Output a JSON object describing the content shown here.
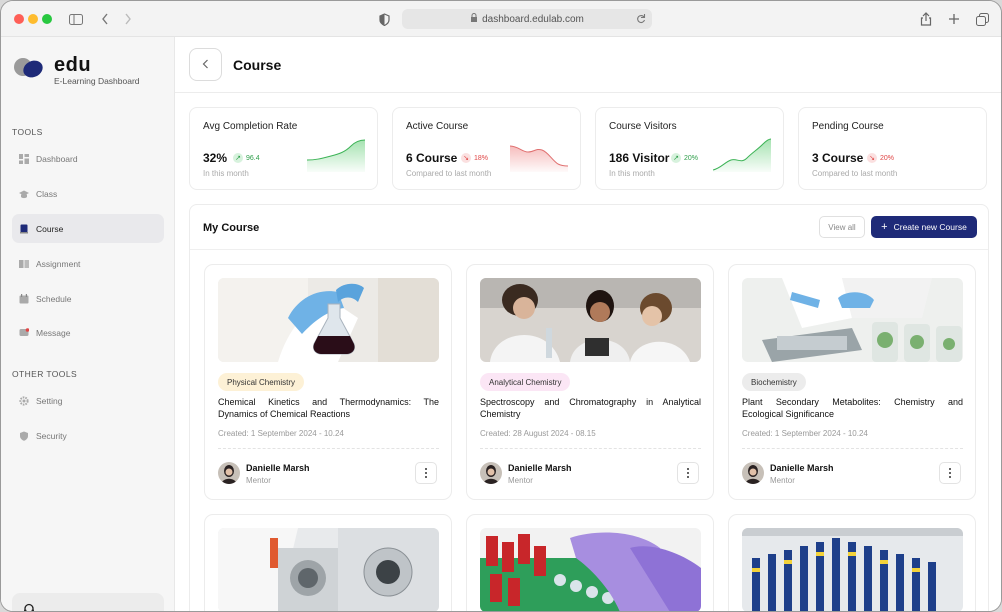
{
  "browser": {
    "url": "dashboard.edulab.com"
  },
  "brand": {
    "name": "edu",
    "subtitle": "E-Learning Dashboard"
  },
  "sidebar": {
    "tools_label": "TOOLS",
    "other_label": "OTHER TOOLS",
    "items": [
      {
        "label": "Dashboard",
        "icon": "dashboard-icon"
      },
      {
        "label": "Class",
        "icon": "graduation-cap-icon"
      },
      {
        "label": "Course",
        "icon": "book-icon",
        "active": true
      },
      {
        "label": "Assignment",
        "icon": "assignment-icon"
      },
      {
        "label": "Schedule",
        "icon": "calendar-icon"
      },
      {
        "label": "Message",
        "icon": "message-icon"
      }
    ],
    "other_items": [
      {
        "label": "Setting",
        "icon": "gear-icon"
      },
      {
        "label": "Security",
        "icon": "shield-icon"
      }
    ]
  },
  "header": {
    "title": "Course"
  },
  "stats": [
    {
      "title": "Avg Completion Rate",
      "value": "32%",
      "change": "96.4",
      "direction": "up",
      "sub": "In this month"
    },
    {
      "title": "Active Course",
      "value": "6 Course",
      "change": "18%",
      "direction": "down",
      "sub": "Compared to last month"
    },
    {
      "title": "Course Visitors",
      "value": "186 Visitor",
      "change": "20%",
      "direction": "up",
      "sub": "In this month"
    },
    {
      "title": "Pending Course",
      "value": "3 Course",
      "change": "20%",
      "direction": "down",
      "sub": "Compared to last month"
    }
  ],
  "my_course": {
    "title": "My Course",
    "view_all": "View all",
    "create_label": "Create new Course",
    "courses": [
      {
        "tag": "Physical Chemistry",
        "title": "Chemical Kinetics and Thermodynamics: The Dynamics of Chemical Reactions",
        "created": "Created: 1 September 2024 - 10.24",
        "mentor": "Danielle Marsh",
        "role": "Mentor"
      },
      {
        "tag": "Analytical Chemistry",
        "title": "Spectroscopy and Chromatography in Analytical Chemistry",
        "created": "Created: 28 August 2024 - 08.15",
        "mentor": "Danielle Marsh",
        "role": "Mentor"
      },
      {
        "tag": "Biochemistry",
        "title": "Plant Secondary Metabolites: Chemistry and Ecological Significance",
        "created": "Created: 1 September 2024 - 10.24",
        "mentor": "Danielle Marsh",
        "role": "Mentor"
      }
    ]
  },
  "colors": {
    "accent": "#1e2a78",
    "up": "#2e9e4a",
    "down": "#e04545",
    "tag_physical": "#fdf1d6",
    "tag_analytical": "#fbe6f5",
    "tag_bio": "#ececec"
  }
}
